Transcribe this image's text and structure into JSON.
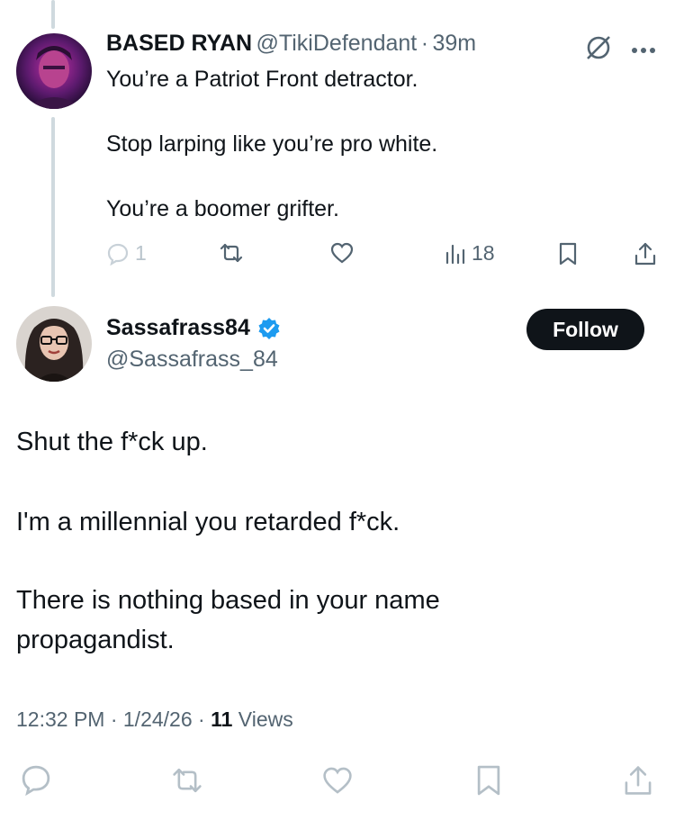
{
  "reply_tweet": {
    "display_name": "BASED RYAN",
    "handle": "@TikiDefendant",
    "separator": "·",
    "time_ago": "39m",
    "lines": [
      "You’re a Patriot Front detractor.",
      "Stop larping like you’re pro white.",
      "You’re a boomer grifter."
    ],
    "actions": {
      "reply_count": "1",
      "views_count": "18"
    },
    "icons": [
      "grok-icon",
      "more-icon",
      "reply-icon",
      "retweet-icon",
      "like-icon",
      "views-icon",
      "bookmark-icon",
      "share-icon"
    ]
  },
  "main_tweet": {
    "display_name": "Sassafrass84",
    "handle": "@Sassafrass_84",
    "verified": true,
    "follow_label": "Follow",
    "paragraphs": [
      "Shut the f*ck up.",
      "I'm a millennial you retarded f*ck.",
      "There is nothing based in your name",
      "propagandist."
    ],
    "timestamp": "12:32 PM · 1/24/26 ·",
    "views_count": "11",
    "views_label": "Views"
  },
  "colors": {
    "text": "#0f1419",
    "secondary": "#536471",
    "verified": "#1d9bf0",
    "thread_line": "#cfd9de",
    "follow_bg": "#0f1419"
  }
}
